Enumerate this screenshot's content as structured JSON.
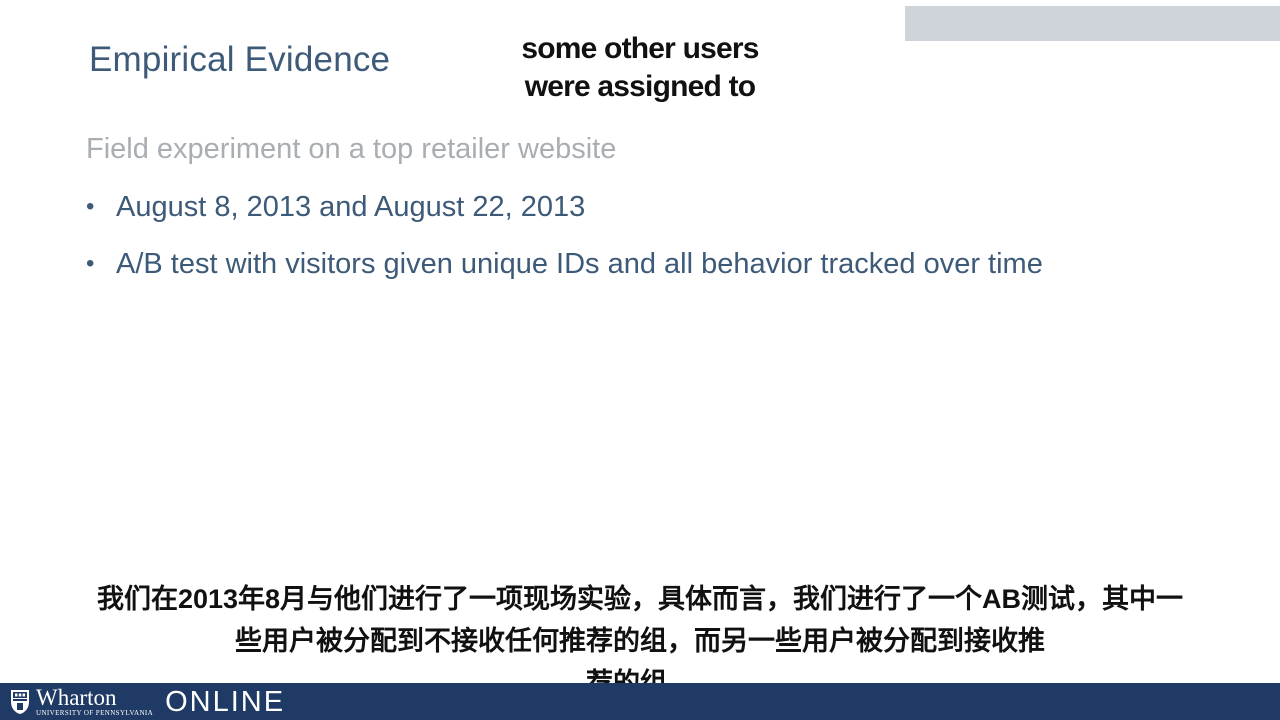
{
  "slide": {
    "title": "Empirical Evidence",
    "subheading": "Field experiment on a top retailer website",
    "bullets": [
      "August 8, 2013 and August 22, 2013",
      "A/B test with visitors given unique IDs and all behavior tracked over time"
    ],
    "bullet_glyph": "•"
  },
  "captions": {
    "english": [
      "some other users",
      "were assigned to"
    ],
    "chinese": [
      "我们在2013年8月与他们进行了一项现场实验，具体而言，我们进行了一个AB测试，其中一",
      "些用户被分配到不接收任何推荐的组，而另一些用户被分配到接收推",
      "荐的组。"
    ]
  },
  "footer": {
    "brand": "Wharton",
    "brand_sub": "University of Pennsylvania",
    "online": "ONLINE",
    "logo_icon": "penn-shield-icon"
  },
  "colors": {
    "title": "#3d5a78",
    "subheading": "#a9aeb3",
    "footer_bar": "#1f3a64",
    "corner_box": "#cfd4da"
  }
}
